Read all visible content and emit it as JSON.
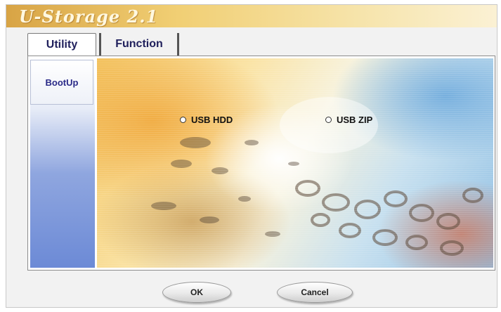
{
  "window": {
    "title": "U-Storage 2.1"
  },
  "tabs": [
    {
      "label": "Utility",
      "active": true
    },
    {
      "label": "Function",
      "active": false
    }
  ],
  "sidebar": {
    "items": [
      {
        "label": "BootUp"
      }
    ]
  },
  "options": {
    "usb_hdd": {
      "label": "USB HDD",
      "selected": false
    },
    "usb_zip": {
      "label": "USB ZIP",
      "selected": false
    }
  },
  "buttons": {
    "ok": "OK",
    "cancel": "Cancel"
  },
  "colors": {
    "title_bar": "#e4b252",
    "tab_text": "#20205c",
    "sidebar_blue": "#6c8ad6"
  }
}
